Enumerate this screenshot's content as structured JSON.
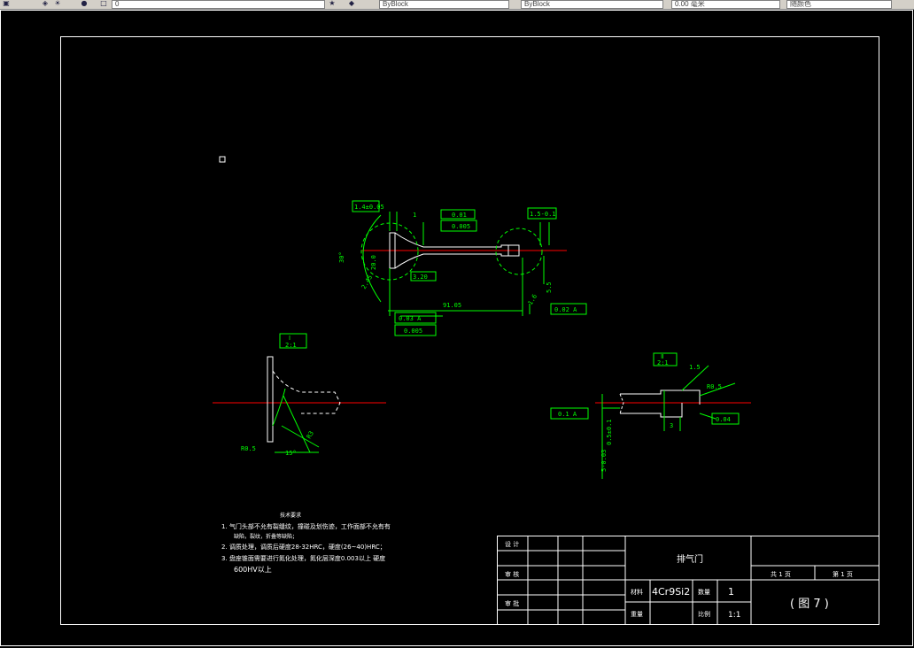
{
  "toolbar": {
    "layer_value": "0",
    "linetype_value": "ByBlock",
    "lineweight_value": "ByBlock",
    "lineweight_width": "0.00 毫米",
    "plotstyle_value": "随颜色"
  },
  "colors": {
    "background": "#000000",
    "border": "#ffffff",
    "dimension": "#00ff00",
    "centerline": "#ff0000",
    "geometry": "#ffffff"
  },
  "dimensions": {
    "d1": "1.4±0.05",
    "d2": "1",
    "d3": "0.01",
    "d4": "0.005",
    "d5": "1.5-0.1",
    "d6": "30°",
    "d7": "20.0",
    "d8": "3.20",
    "d9": "2.45",
    "d10": "91.05",
    "d11": "0.03 A",
    "d12": "0.005",
    "d13": "0.02 A",
    "d14": "5.5",
    "d15": "1.6",
    "d16": "Ⅰ",
    "d17": "2:1",
    "d18": "R0.5",
    "d19": "15°",
    "d20": "R3",
    "d21": "Ⅱ",
    "d22": "2:1",
    "d23": "1.5",
    "d24": "R0.5",
    "d25": "0.1 A",
    "d26": "5-0.03",
    "d27": "0.04",
    "d28": "3",
    "d29": "0.5±0.1"
  },
  "notes": {
    "title": "技术要求",
    "line1": "1.  气门头部不允有裂缝纹，撞碰及划伤迹，工作面部不允有有",
    "line1b": "缺陷，裂纹，折叠等缺陷；",
    "line2": "2.  调质处理，调质后硬度28-32HRC，硬度(26~40)HRC；",
    "line3": "3.  盘座锥面需要进行氮化处理，氮化层深度0.003以上 硬度",
    "line3b": "600HV以上"
  },
  "title_block": {
    "label_design": "设 计",
    "label_check": "审 核",
    "label_approve": "审 批",
    "part_name": "排气门",
    "label_material": "材料",
    "material": "4Cr9Si2",
    "label_qty": "数量",
    "qty": "1",
    "label_weight": "重量",
    "label_scale": "比例",
    "scale": "1:1",
    "sheets_total": "共 1 页",
    "sheet_no": "第 1 页",
    "drawing_no": "( 图 7 )"
  }
}
